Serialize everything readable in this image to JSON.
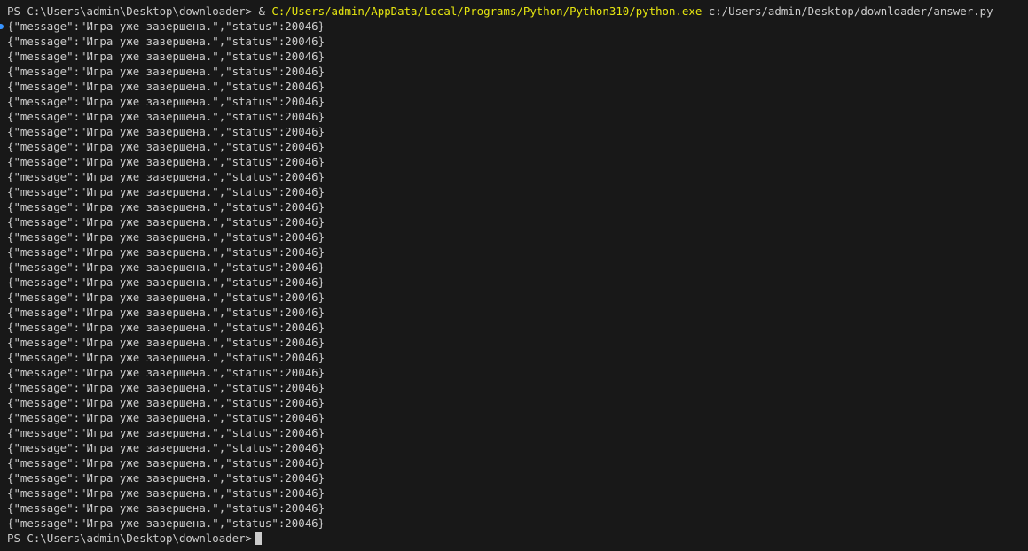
{
  "terminal": {
    "command_line": {
      "prompt": "PS C:\\Users\\admin\\Desktop\\downloader> ",
      "operator": "& ",
      "executable": "C:/Users/admin/AppData/Local/Programs/Python/Python310/python.exe",
      "argument": " c:/Users/admin/Desktop/downloader/answer.py"
    },
    "output_lines": [
      "{\"message\":\"Игра уже завершена.\",\"status\":20046}",
      "{\"message\":\"Игра уже завершена.\",\"status\":20046}",
      "{\"message\":\"Игра уже завершена.\",\"status\":20046}",
      "{\"message\":\"Игра уже завершена.\",\"status\":20046}",
      "{\"message\":\"Игра уже завершена.\",\"status\":20046}",
      "{\"message\":\"Игра уже завершена.\",\"status\":20046}",
      "{\"message\":\"Игра уже завершена.\",\"status\":20046}",
      "{\"message\":\"Игра уже завершена.\",\"status\":20046}",
      "{\"message\":\"Игра уже завершена.\",\"status\":20046}",
      "{\"message\":\"Игра уже завершена.\",\"status\":20046}",
      "{\"message\":\"Игра уже завершена.\",\"status\":20046}",
      "{\"message\":\"Игра уже завершена.\",\"status\":20046}",
      "{\"message\":\"Игра уже завершена.\",\"status\":20046}",
      "{\"message\":\"Игра уже завершена.\",\"status\":20046}",
      "{\"message\":\"Игра уже завершена.\",\"status\":20046}",
      "{\"message\":\"Игра уже завершена.\",\"status\":20046}",
      "{\"message\":\"Игра уже завершена.\",\"status\":20046}",
      "{\"message\":\"Игра уже завершена.\",\"status\":20046}",
      "{\"message\":\"Игра уже завершена.\",\"status\":20046}",
      "{\"message\":\"Игра уже завершена.\",\"status\":20046}",
      "{\"message\":\"Игра уже завершена.\",\"status\":20046}",
      "{\"message\":\"Игра уже завершена.\",\"status\":20046}",
      "{\"message\":\"Игра уже завершена.\",\"status\":20046}",
      "{\"message\":\"Игра уже завершена.\",\"status\":20046}",
      "{\"message\":\"Игра уже завершена.\",\"status\":20046}",
      "{\"message\":\"Игра уже завершена.\",\"status\":20046}",
      "{\"message\":\"Игра уже завершена.\",\"status\":20046}",
      "{\"message\":\"Игра уже завершена.\",\"status\":20046}",
      "{\"message\":\"Игра уже завершена.\",\"status\":20046}",
      "{\"message\":\"Игра уже завершена.\",\"status\":20046}",
      "{\"message\":\"Игра уже завершена.\",\"status\":20046}",
      "{\"message\":\"Игра уже завершена.\",\"status\":20046}",
      "{\"message\":\"Игра уже завершена.\",\"status\":20046}",
      "{\"message\":\"Игра уже завершена.\",\"status\":20046}"
    ],
    "final_prompt": "PS C:\\Users\\admin\\Desktop\\downloader>",
    "colors": {
      "background": "#181818",
      "text": "#cccccc",
      "executable_path": "#e5e510",
      "gutter_marker": "#3794ff"
    }
  }
}
